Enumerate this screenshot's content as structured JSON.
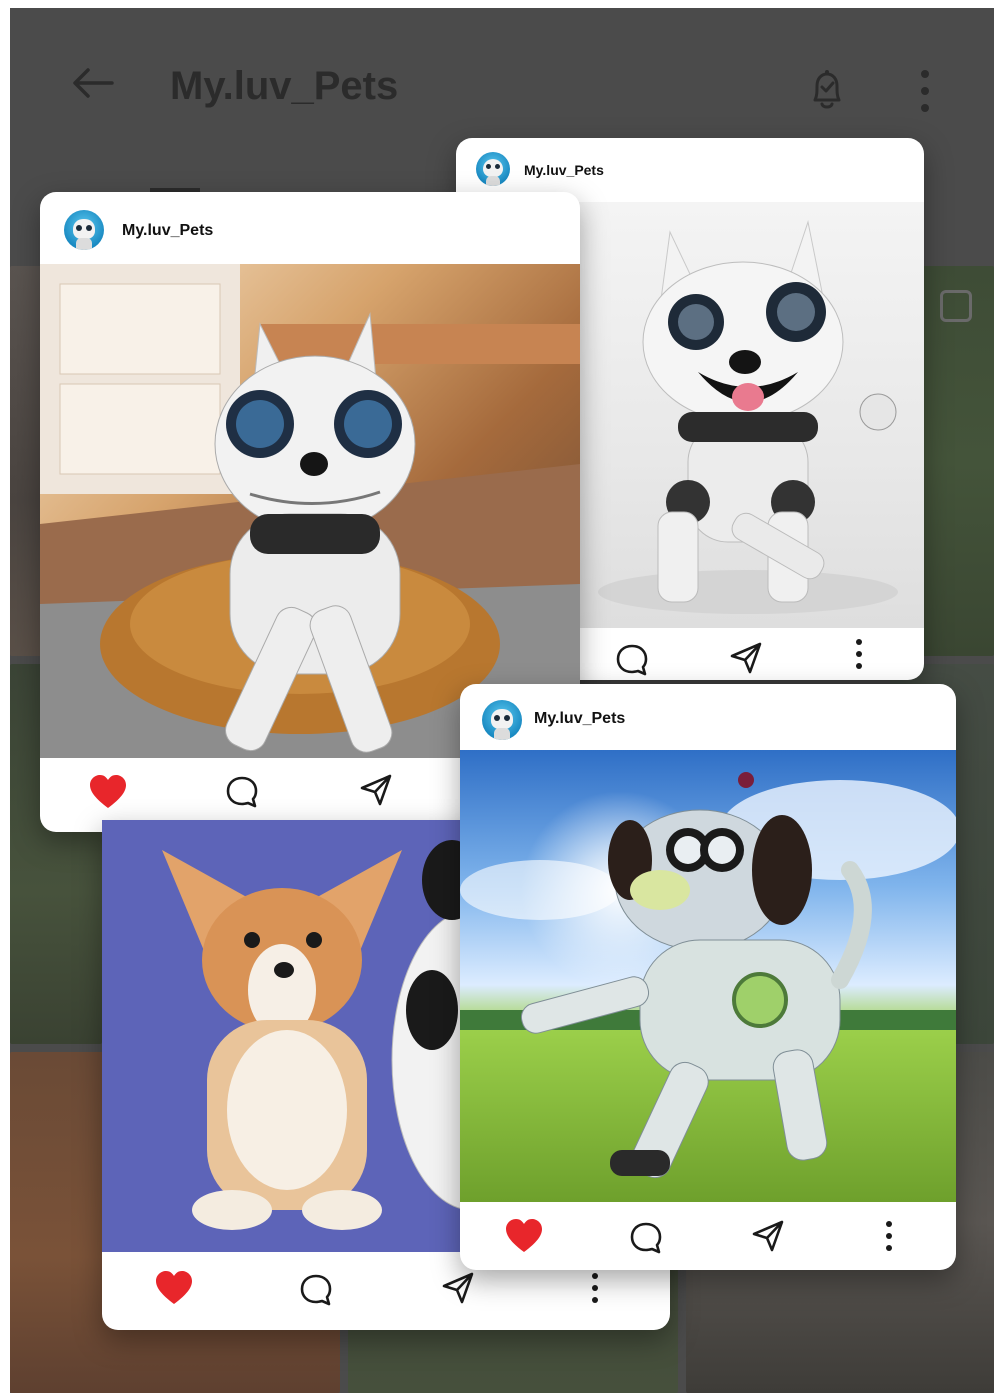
{
  "header": {
    "title": "My.luv_Pets",
    "back_icon": "back-arrow-icon",
    "notification_icon": "bell-check-icon",
    "menu_icon": "more-vertical-icon"
  },
  "posts": [
    {
      "id": "post-robot-white",
      "username": "My.luv_Pets",
      "photo": "robot dog with tongue out on white background",
      "actions": [
        "comment-icon",
        "share-icon",
        "more-vertical-icon"
      ]
    },
    {
      "id": "post-robot-cushion",
      "username": "My.luv_Pets",
      "photo": "robot dog lying on cushion in sunny room",
      "liked": true,
      "actions": [
        "heart-icon",
        "comment-icon",
        "share-icon"
      ]
    },
    {
      "id": "post-puppy",
      "username": "",
      "photo": "corgi puppy next to robot dog on blue background",
      "liked": true,
      "actions": [
        "heart-icon",
        "comment-icon",
        "share-icon",
        "more-vertical-icon"
      ]
    },
    {
      "id": "post-robot-field",
      "username": "My.luv_Pets",
      "photo": "robot dog walking in green field under blue sky",
      "liked": true,
      "actions": [
        "heart-icon",
        "comment-icon",
        "share-icon",
        "more-vertical-icon"
      ]
    }
  ],
  "colors": {
    "like_red": "#e8262b",
    "overlay": "#4b4b4b",
    "avatar_blue": "#2aa5dc"
  }
}
